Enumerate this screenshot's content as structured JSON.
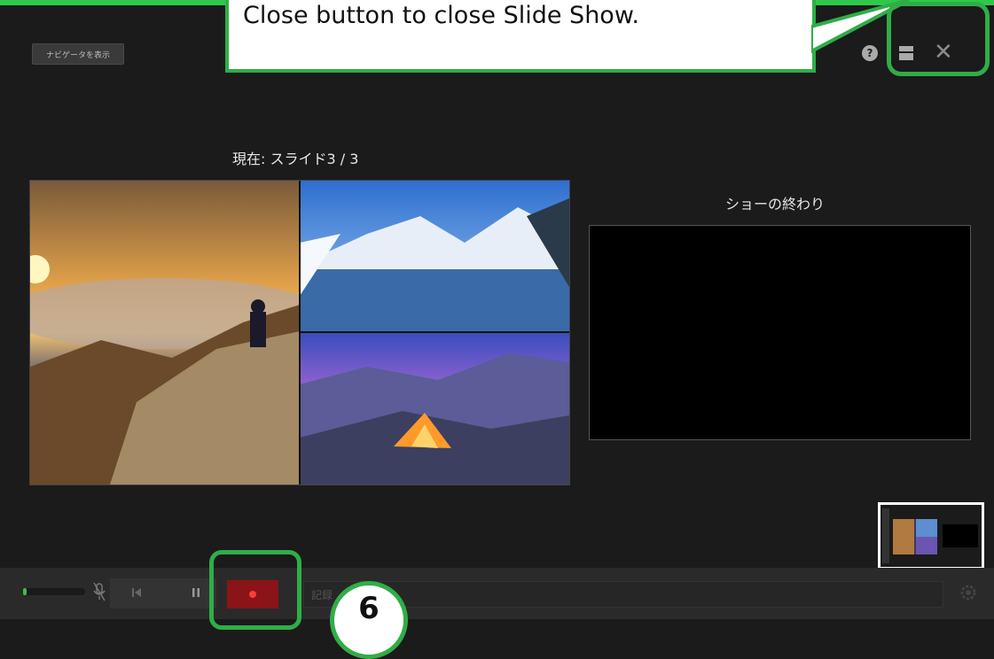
{
  "callout": {
    "text": "Close button to close Slide Show."
  },
  "header": {
    "navigator_button_label": "ナビゲータを表示"
  },
  "icons": {
    "help": "help-icon",
    "layout": "layout-icon",
    "close": "close-icon",
    "mic": "mic-off-icon",
    "prev": "previous-icon",
    "pause": "pause-icon",
    "record": "record-icon",
    "settings": "settings-icon"
  },
  "presenter": {
    "current_slide_label": "現在: スライド3 / 3",
    "next_slide_label": "ショーの終わり"
  },
  "toolbar": {
    "notes_placeholder": "記録",
    "volume_level": 0.05
  },
  "annotation": {
    "step_number": "6"
  },
  "colors": {
    "highlight": "#2fae47",
    "record": "#8a1418",
    "volume": "#3fbf3f"
  }
}
